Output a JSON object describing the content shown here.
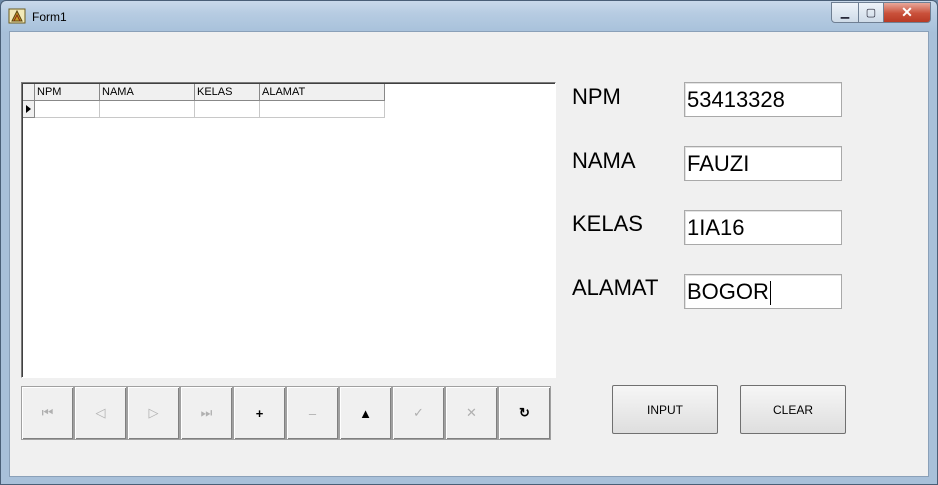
{
  "window": {
    "title": "Form1",
    "controls": {
      "minimize": "▁",
      "maximize": "▢",
      "close": "✕"
    }
  },
  "grid": {
    "columns": [
      "NPM",
      "NAMA",
      "KELAS",
      "ALAMAT"
    ],
    "rows": [
      [
        "",
        "",
        "",
        ""
      ]
    ]
  },
  "navigator": {
    "buttons": [
      {
        "name": "first-record",
        "glyph": "⏮",
        "enabled": false
      },
      {
        "name": "prior-record",
        "glyph": "◁",
        "enabled": false
      },
      {
        "name": "next-record",
        "glyph": "▷",
        "enabled": false
      },
      {
        "name": "last-record",
        "glyph": "⏭",
        "enabled": false
      },
      {
        "name": "insert-record",
        "glyph": "+",
        "enabled": true
      },
      {
        "name": "delete-record",
        "glyph": "–",
        "enabled": false
      },
      {
        "name": "edit-record",
        "glyph": "▲",
        "enabled": true
      },
      {
        "name": "post-edit",
        "glyph": "✓",
        "enabled": false
      },
      {
        "name": "cancel-edit",
        "glyph": "✕",
        "enabled": false
      },
      {
        "name": "refresh-data",
        "glyph": "↻",
        "enabled": true
      }
    ]
  },
  "form": {
    "npm_label": "NPM",
    "npm_value": "53413328",
    "nama_label": "NAMA",
    "nama_value": "FAUZI",
    "kelas_label": "KELAS",
    "kelas_value": "1IA16",
    "alamat_label": "ALAMAT",
    "alamat_value": "BOGOR"
  },
  "buttons": {
    "input": "INPUT",
    "clear": "CLEAR"
  }
}
